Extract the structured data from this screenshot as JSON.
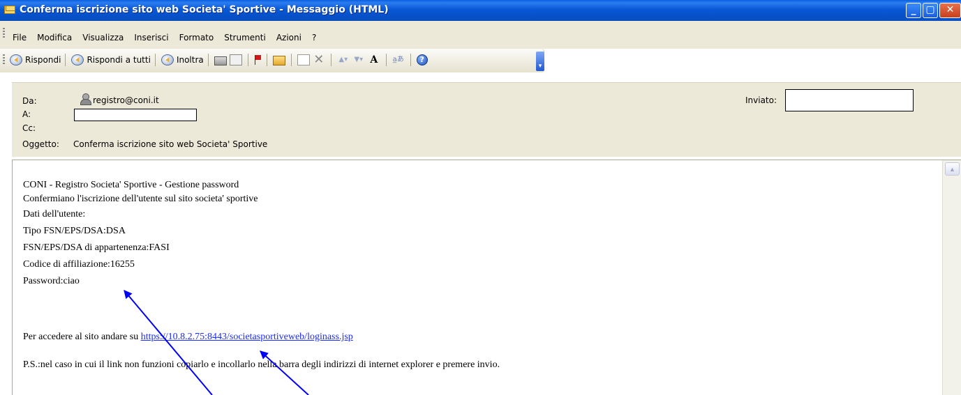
{
  "window": {
    "title": "Conferma iscrizione sito web Societa' Sportive - Messaggio (HTML)"
  },
  "window_controls": {
    "minimize": "_",
    "maximize": "▢",
    "close": "✕"
  },
  "menu": {
    "items": [
      "File",
      "Modifica",
      "Visualizza",
      "Inserisci",
      "Formato",
      "Strumenti",
      "Azioni",
      "?"
    ]
  },
  "toolbar": {
    "reply_label": "Rispondi",
    "reply_all_label": "Rispondi a tutti",
    "forward_label": "Inoltra",
    "font_glyph": "A",
    "help_glyph": "?",
    "icons": [
      "reply-icon",
      "reply-all-icon",
      "forward-icon",
      "print-icon",
      "copy-icon",
      "flag-icon",
      "folder-icon",
      "move-icon",
      "delete-icon",
      "previous-icon",
      "next-icon",
      "font-size-icon",
      "encoding-icon",
      "help-icon",
      "toolbar-options-icon"
    ]
  },
  "header": {
    "from_label": "Da:",
    "from_value": "registro@coni.it",
    "to_label": "A:",
    "cc_label": "Cc:",
    "subject_label": "Oggetto:",
    "subject_value": "Conferma iscrizione sito web Societa' Sportive",
    "sent_label": "Inviato:"
  },
  "body": {
    "line1": "CONI - Registro Societa' Sportive - Gestione password",
    "line2": "Confermiano l'iscrizione dell'utente sul sito societa' sportive",
    "line3": "Dati dell'utente:",
    "line4": "Tipo FSN/EPS/DSA:DSA",
    "line5": "FSN/EPS/DSA di appartenenza:FASI",
    "line6": "Codice di affiliazione:16255",
    "line7": "Password:ciao",
    "access_prefix": "Per accedere al sito andare su ",
    "access_link": "https://10.8.2.75:8443/societasportiveweb/loginass.jsp",
    "ps": "P.S.:nel caso in cui il link non funzioni copiarlo e incollarlo nella barra degli indirizzi di internet explorer e premere invio."
  },
  "colors": {
    "titlebar": "#0a58d6",
    "chrome": "#ece9d8",
    "link": "#1a2cff",
    "annotation_arrow": "#0000ff"
  }
}
